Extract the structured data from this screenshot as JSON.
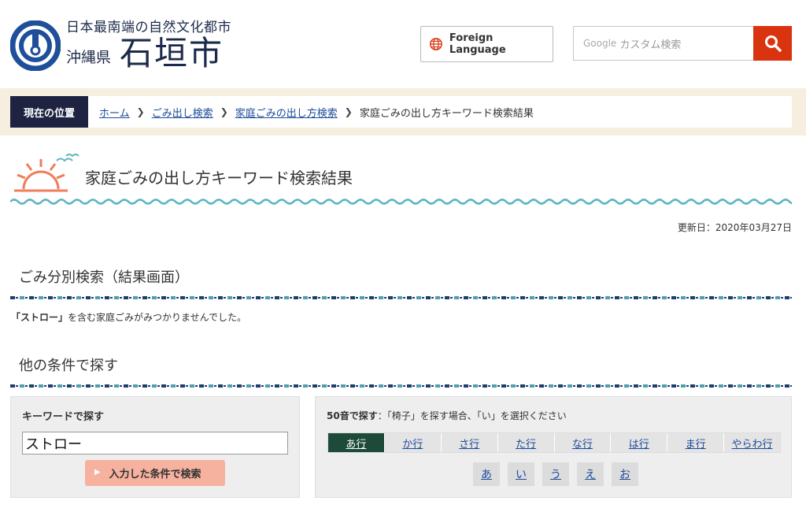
{
  "header": {
    "tagline": "日本最南端の自然文化都市",
    "prefecture": "沖縄県",
    "city": "石垣市",
    "lang_button": "Foreign Language",
    "search_google": "Google",
    "search_placeholder": "カスタム検索",
    "icons": {
      "logo": "city-emblem-icon",
      "globe": "globe-icon",
      "search": "search-icon"
    },
    "colors": {
      "navy": "#1c2a4a",
      "search_red": "#d9330f"
    }
  },
  "breadcrumb": {
    "label": "現在の位置",
    "items": [
      "ホーム",
      "ごみ出し検索",
      "家庭ごみの出し方検索"
    ],
    "current": "家庭ごみの出し方キーワード検索結果"
  },
  "page": {
    "title": "家庭ごみの出し方キーワード検索結果",
    "updated": "更新日：2020年03月27日"
  },
  "result_section": {
    "heading": "ごみ分別検索（結果画面）",
    "message_keyword": "「ストロー」",
    "message_rest": "を含む家庭ごみがみつかりませんでした。"
  },
  "other_section": {
    "heading": "他の条件で探す"
  },
  "keyword_search": {
    "title": "キーワードで探す",
    "value": "ストロー",
    "button": "入力した条件で検索"
  },
  "kana_search": {
    "title_bold": "50音で探す",
    "title_rest": "：「椅子」を探す場合、「い」を選択ください",
    "tabs": [
      "あ行",
      "か行",
      "さ行",
      "た行",
      "な行",
      "は行",
      "ま行",
      "やらわ行"
    ],
    "active_tab": "あ行",
    "chars": [
      "あ",
      "い",
      "う",
      "え",
      "お"
    ]
  }
}
